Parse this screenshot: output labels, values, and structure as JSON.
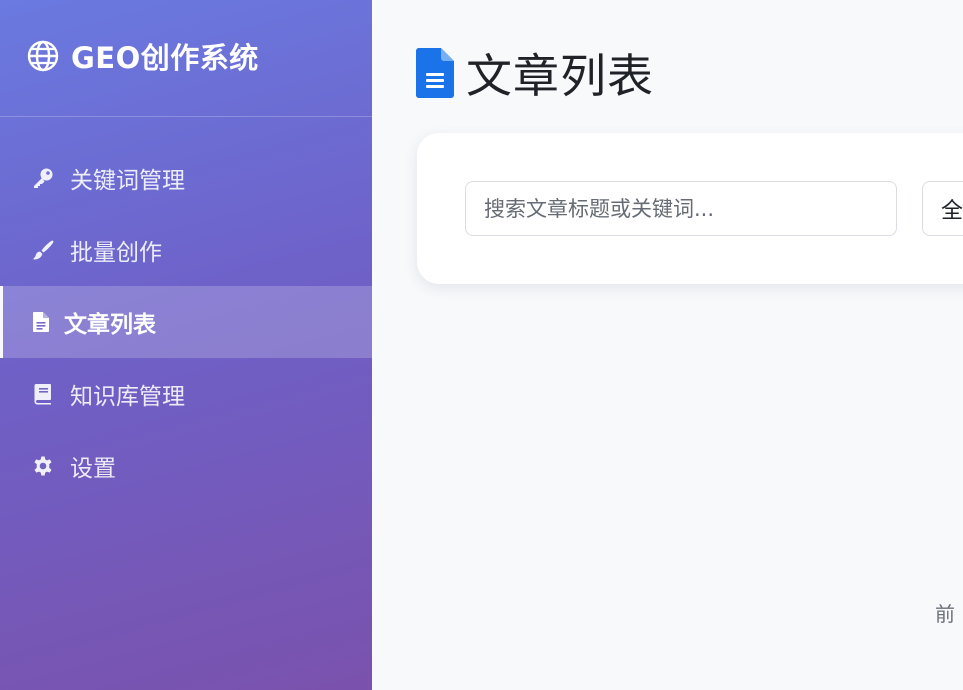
{
  "sidebar": {
    "brand": {
      "title": "GEO创作系统",
      "icon": "globe-icon"
    },
    "items": [
      {
        "label": "关键词管理",
        "icon": "key-icon",
        "active": false
      },
      {
        "label": "批量创作",
        "icon": "paintbrush-icon",
        "active": false
      },
      {
        "label": "文章列表",
        "icon": "file-text-icon",
        "active": true
      },
      {
        "label": "知识库管理",
        "icon": "book-icon",
        "active": false
      },
      {
        "label": "设置",
        "icon": "gear-icon",
        "active": false
      }
    ],
    "colors": {
      "gradient_start": "#6a7ae0",
      "gradient_end": "#7a52ad"
    }
  },
  "main": {
    "header": {
      "title": "文章列表",
      "icon": "file-text-icon",
      "icon_color": "#1a73e8"
    },
    "filters": {
      "search_placeholder": "搜索文章标题或关键词...",
      "status_select_value": "全"
    },
    "pagination": {
      "text": "前"
    }
  }
}
